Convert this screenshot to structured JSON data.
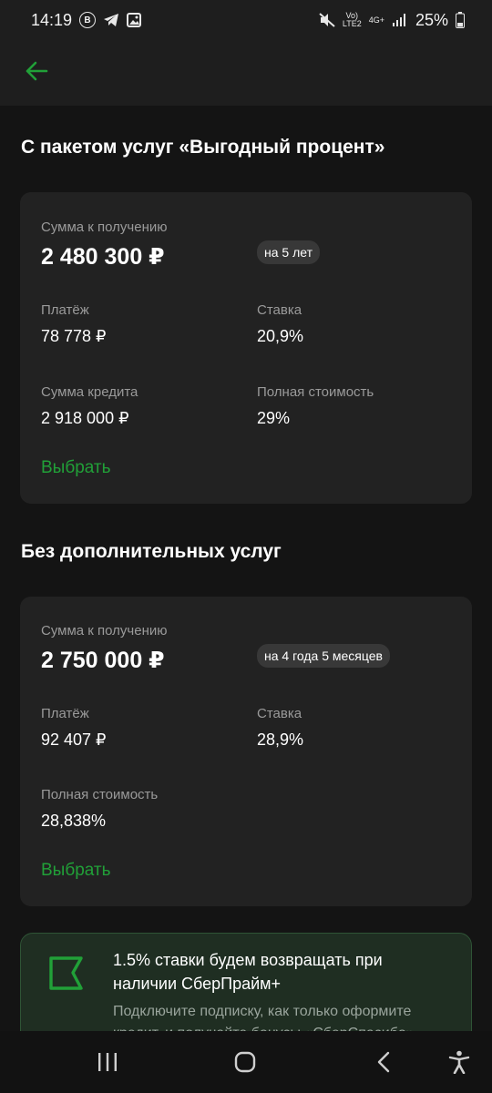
{
  "status_bar": {
    "time": "14:19",
    "badge": "B",
    "volte": "Vo)\nLTE2",
    "network": "4G+",
    "battery": "25%"
  },
  "offers": [
    {
      "section_title": "С пакетом услуг «Выгодный процент»",
      "amount_label": "Сумма к получению",
      "amount": "2 480 300 ₽",
      "term": "на 5 лет",
      "payment_label": "Платёж",
      "payment": "78 778 ₽",
      "rate_label": "Ставка",
      "rate": "20,9%",
      "credit_label": "Сумма кредита",
      "credit": "2 918 000 ₽",
      "full_cost_label": "Полная стоимость",
      "full_cost": "29%",
      "select_label": "Выбрать"
    },
    {
      "section_title": "Без дополнительных услуг",
      "amount_label": "Сумма к получению",
      "amount": "2 750 000 ₽",
      "term": "на 4 года 5 месяцев",
      "payment_label": "Платёж",
      "payment": "92 407 ₽",
      "rate_label": "Ставка",
      "rate": "28,9%",
      "full_cost_label": "Полная стоимость",
      "full_cost": "28,838%",
      "select_label": "Выбрать"
    }
  ],
  "promo": {
    "title": "1.5% ставки будем возвращать при наличии СберПрайм+",
    "text": "Подключите подписку, как только оформите кредит, и получайте бонусы «СберСпасибо»"
  },
  "colors": {
    "accent": "#21a038",
    "background": "#141414",
    "card": "#222222",
    "promo_bg": "#1f2e22"
  }
}
